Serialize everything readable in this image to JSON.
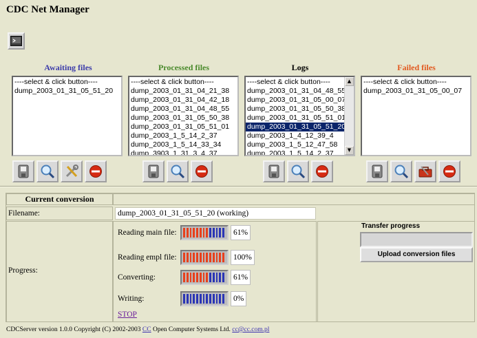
{
  "app": {
    "title": "CDC Net Manager"
  },
  "colors": {
    "awaiting": "#3c3caa",
    "processed": "#4a8a2c",
    "logs": "#000000",
    "failed": "#e25a20",
    "bar_red": "#e8401c",
    "bar_blue": "#2a35b5"
  },
  "columns": {
    "awaiting": {
      "header": "Awaiting files",
      "items": [
        "----select & click button----",
        "dump_2003_01_31_05_51_20"
      ]
    },
    "processed": {
      "header": "Processed files",
      "items": [
        "----select & click button----",
        "dump_2003_01_31_04_21_38",
        "dump_2003_01_31_04_42_18",
        "dump_2003_01_31_04_48_55",
        "dump_2003_01_31_05_50_38",
        "dump_2003_01_31_05_51_01",
        "dump_2003_1_5_14_2_37",
        "dump_2003_1_5_14_33_34",
        "dump_3903_1_31_3_4_37"
      ]
    },
    "logs": {
      "header": "Logs",
      "items": [
        "----select & click button----",
        "dump_2003_01_31_04_48_55",
        "dump_2003_01_31_05_00_07",
        "dump_2003_01_31_05_50_38",
        "dump_2003_01_31_05_51_01",
        "dump_2003_01_31_05_51_20",
        "dump_2003_1_4_12_39_4",
        "dump_2003_1_5_12_47_58",
        "dump_2003_1_5_14_2_37"
      ],
      "selected": "dump_2003_01_31_05_51_20"
    },
    "failed": {
      "header": "Failed files",
      "items": [
        "----select & click button----",
        "dump_2003_01_31_05_00_07"
      ]
    }
  },
  "conversion": {
    "header": "Current conversion",
    "filename_label": "Filename:",
    "filename_value": "dump_2003_01_31_05_51_20 (working)",
    "progress_label": "Progress:",
    "steps": [
      {
        "label": "Reading main file:",
        "percent_text": "61%",
        "progress": 0.61
      },
      {
        "label": "Reading empl file:",
        "percent_text": "100%",
        "progress": 1.0
      },
      {
        "label": "Converting:",
        "percent_text": "61%",
        "progress": 0.61
      },
      {
        "label": "Writing:",
        "percent_text": "0%",
        "progress": 0.0
      }
    ],
    "stop_label": "STOP",
    "transfer_title": "Transfer progress",
    "upload_label": "Upload conversion files"
  },
  "footer": {
    "prefix": "CDCServer version 1.0.0  Copyright (C) 2002-2003 ",
    "cc_link": "CC",
    "middle": " Open Computer Systems Ltd. ",
    "email_link": "cc@cc.com.pl"
  }
}
